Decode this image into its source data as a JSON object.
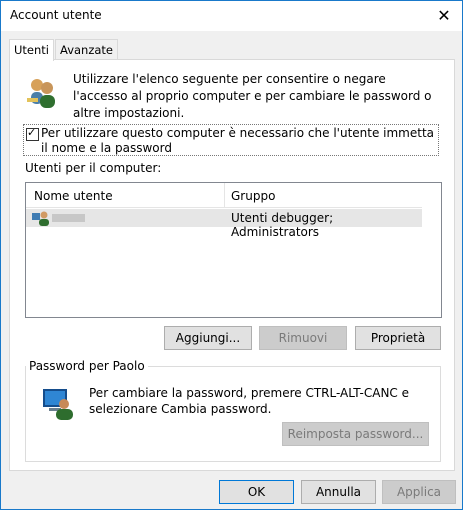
{
  "window": {
    "title": "Account utente",
    "close_glyph": "✕"
  },
  "tabs": [
    {
      "label": "Utenti",
      "active": true
    },
    {
      "label": "Avanzate",
      "active": false
    }
  ],
  "intro": {
    "text": "Utilizzare l'elenco seguente per consentire o negare l'accesso al proprio computer e per cambiare le password o altre impostazioni."
  },
  "require_login": {
    "label": "Per utilizzare questo computer è necessario che l'utente immetta il nome e la password",
    "checked": true
  },
  "users_section": {
    "label": "Utenti per il computer:",
    "columns": [
      "Nome utente",
      "Gruppo"
    ],
    "rows": [
      {
        "group": "Utenti debugger; Administrators"
      }
    ]
  },
  "user_buttons": {
    "add": "Aggiungi...",
    "remove": "Rimuovi",
    "properties": "Proprietà"
  },
  "password": {
    "title": "Password per Paolo",
    "text": "Per cambiare la password, premere CTRL-ALT-CANC e selezionare Cambia password.",
    "reset": "Reimposta password..."
  },
  "footer": {
    "ok": "OK",
    "cancel": "Annulla",
    "apply": "Applica"
  },
  "icons": {
    "users": "users-icon",
    "user": "user-icon",
    "password": "computer-user-icon"
  },
  "colors": {
    "window_border": "#1979ca",
    "focus_border": "#0078d7",
    "selected_row": "#e6e6e6"
  }
}
